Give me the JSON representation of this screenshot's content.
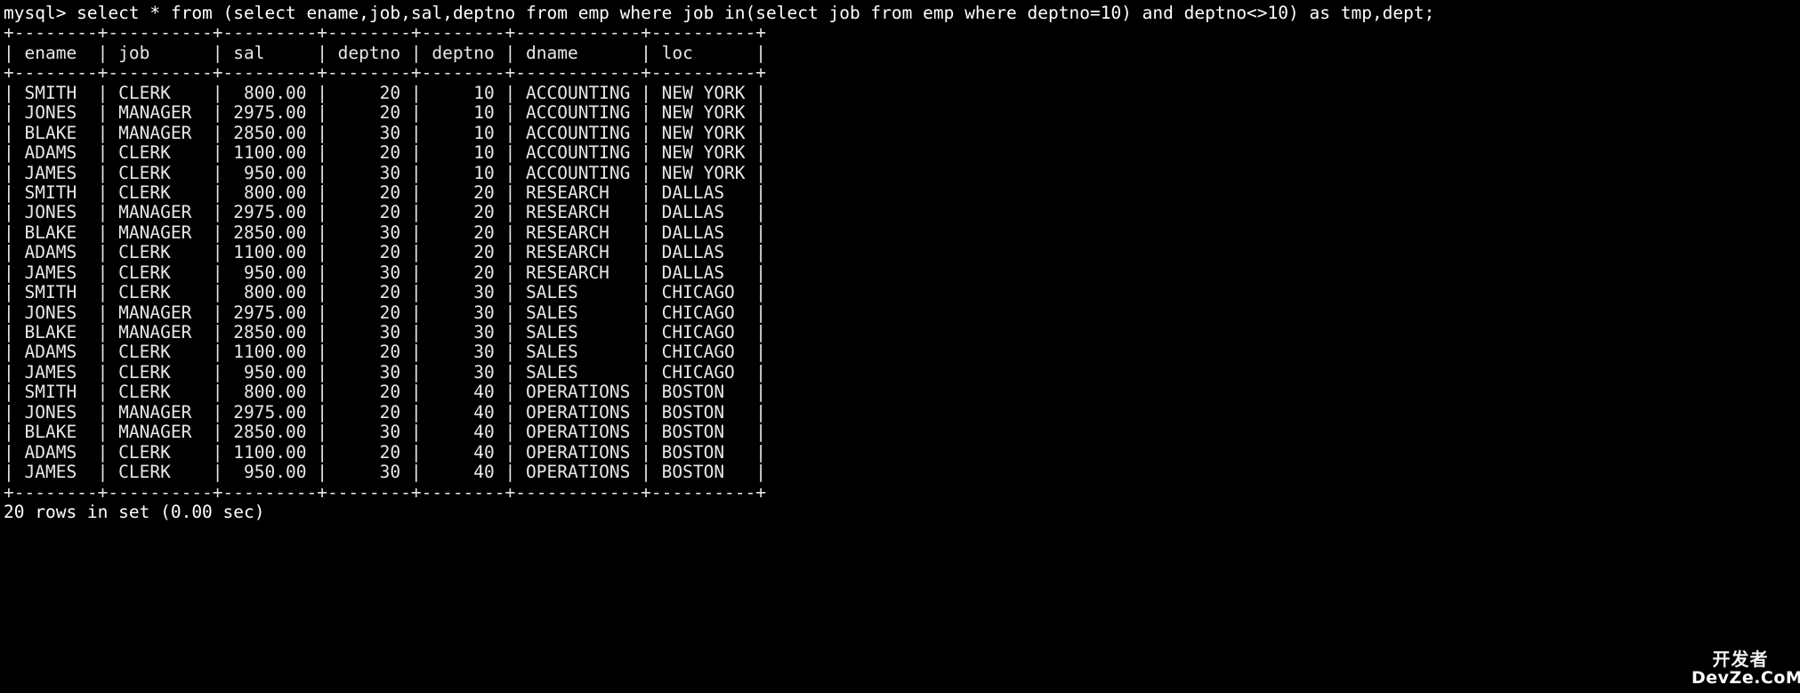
{
  "terminal": {
    "background_color": "#000000",
    "foreground_color": "#e8e8e8",
    "prompt": "mysql>",
    "query": "mysql> select * from (select ename,job,sal,deptno from emp where job in(select job from emp where deptno=10) and deptno<>10) as tmp,dept;",
    "footer": "20 rows in set (0.00 sec)",
    "row_count": 20,
    "elapsed": "0.00 sec"
  },
  "result_table": {
    "border_top": "+--------+----------+---------+--------+--------+------------+----------+",
    "border_header": "+--------+----------+---------+--------+--------+------------+----------+",
    "border_bottom": "+--------+----------+---------+--------+--------+------------+----------+",
    "header_line": "| ename  | job      | sal     | deptno | deptno | dname      | loc      |",
    "columns": [
      "ename",
      "job",
      "sal",
      "deptno",
      "deptno",
      "dname",
      "loc"
    ],
    "rows": [
      "| SMITH  | CLERK    |  800.00 |     20 |     10 | ACCOUNTING | NEW YORK |",
      "| JONES  | MANAGER  | 2975.00 |     20 |     10 | ACCOUNTING | NEW YORK |",
      "| BLAKE  | MANAGER  | 2850.00 |     30 |     10 | ACCOUNTING | NEW YORK |",
      "| ADAMS  | CLERK    | 1100.00 |     20 |     10 | ACCOUNTING | NEW YORK |",
      "| JAMES  | CLERK    |  950.00 |     30 |     10 | ACCOUNTING | NEW YORK |",
      "| SMITH  | CLERK    |  800.00 |     20 |     20 | RESEARCH   | DALLAS   |",
      "| JONES  | MANAGER  | 2975.00 |     20 |     20 | RESEARCH   | DALLAS   |",
      "| BLAKE  | MANAGER  | 2850.00 |     30 |     20 | RESEARCH   | DALLAS   |",
      "| ADAMS  | CLERK    | 1100.00 |     20 |     20 | RESEARCH   | DALLAS   |",
      "| JAMES  | CLERK    |  950.00 |     30 |     20 | RESEARCH   | DALLAS   |",
      "| SMITH  | CLERK    |  800.00 |     20 |     30 | SALES      | CHICAGO  |",
      "| JONES  | MANAGER  | 2975.00 |     20 |     30 | SALES      | CHICAGO  |",
      "| BLAKE  | MANAGER  | 2850.00 |     30 |     30 | SALES      | CHICAGO  |",
      "| ADAMS  | CLERK    | 1100.00 |     20 |     30 | SALES      | CHICAGO  |",
      "| JAMES  | CLERK    |  950.00 |     30 |     30 | SALES      | CHICAGO  |",
      "| SMITH  | CLERK    |  800.00 |     20 |     40 | OPERATIONS | BOSTON   |",
      "| JONES  | MANAGER  | 2975.00 |     20 |     40 | OPERATIONS | BOSTON   |",
      "| BLAKE  | MANAGER  | 2850.00 |     30 |     40 | OPERATIONS | BOSTON   |",
      "| ADAMS  | CLERK    | 1100.00 |     20 |     40 | OPERATIONS | BOSTON   |",
      "| JAMES  | CLERK    |  950.00 |     30 |     40 | OPERATIONS | BOSTON   |"
    ],
    "records": [
      {
        "ename": "SMITH",
        "job": "CLERK",
        "sal": "800.00",
        "deptno_emp": "20",
        "deptno_dept": "10",
        "dname": "ACCOUNTING",
        "loc": "NEW YORK"
      },
      {
        "ename": "JONES",
        "job": "MANAGER",
        "sal": "2975.00",
        "deptno_emp": "20",
        "deptno_dept": "10",
        "dname": "ACCOUNTING",
        "loc": "NEW YORK"
      },
      {
        "ename": "BLAKE",
        "job": "MANAGER",
        "sal": "2850.00",
        "deptno_emp": "30",
        "deptno_dept": "10",
        "dname": "ACCOUNTING",
        "loc": "NEW YORK"
      },
      {
        "ename": "ADAMS",
        "job": "CLERK",
        "sal": "1100.00",
        "deptno_emp": "20",
        "deptno_dept": "10",
        "dname": "ACCOUNTING",
        "loc": "NEW YORK"
      },
      {
        "ename": "JAMES",
        "job": "CLERK",
        "sal": "950.00",
        "deptno_emp": "30",
        "deptno_dept": "10",
        "dname": "ACCOUNTING",
        "loc": "NEW YORK"
      },
      {
        "ename": "SMITH",
        "job": "CLERK",
        "sal": "800.00",
        "deptno_emp": "20",
        "deptno_dept": "20",
        "dname": "RESEARCH",
        "loc": "DALLAS"
      },
      {
        "ename": "JONES",
        "job": "MANAGER",
        "sal": "2975.00",
        "deptno_emp": "20",
        "deptno_dept": "20",
        "dname": "RESEARCH",
        "loc": "DALLAS"
      },
      {
        "ename": "BLAKE",
        "job": "MANAGER",
        "sal": "2850.00",
        "deptno_emp": "30",
        "deptno_dept": "20",
        "dname": "RESEARCH",
        "loc": "DALLAS"
      },
      {
        "ename": "ADAMS",
        "job": "CLERK",
        "sal": "1100.00",
        "deptno_emp": "20",
        "deptno_dept": "20",
        "dname": "RESEARCH",
        "loc": "DALLAS"
      },
      {
        "ename": "JAMES",
        "job": "CLERK",
        "sal": "950.00",
        "deptno_emp": "30",
        "deptno_dept": "20",
        "dname": "RESEARCH",
        "loc": "DALLAS"
      },
      {
        "ename": "SMITH",
        "job": "CLERK",
        "sal": "800.00",
        "deptno_emp": "20",
        "deptno_dept": "30",
        "dname": "SALES",
        "loc": "CHICAGO"
      },
      {
        "ename": "JONES",
        "job": "MANAGER",
        "sal": "2975.00",
        "deptno_emp": "20",
        "deptno_dept": "30",
        "dname": "SALES",
        "loc": "CHICAGO"
      },
      {
        "ename": "BLAKE",
        "job": "MANAGER",
        "sal": "2850.00",
        "deptno_emp": "30",
        "deptno_dept": "30",
        "dname": "SALES",
        "loc": "CHICAGO"
      },
      {
        "ename": "ADAMS",
        "job": "CLERK",
        "sal": "1100.00",
        "deptno_emp": "20",
        "deptno_dept": "30",
        "dname": "SALES",
        "loc": "CHICAGO"
      },
      {
        "ename": "JAMES",
        "job": "CLERK",
        "sal": "950.00",
        "deptno_emp": "30",
        "deptno_dept": "30",
        "dname": "SALES",
        "loc": "CHICAGO"
      },
      {
        "ename": "SMITH",
        "job": "CLERK",
        "sal": "800.00",
        "deptno_emp": "20",
        "deptno_dept": "40",
        "dname": "OPERATIONS",
        "loc": "BOSTON"
      },
      {
        "ename": "JONES",
        "job": "MANAGER",
        "sal": "2975.00",
        "deptno_emp": "20",
        "deptno_dept": "40",
        "dname": "OPERATIONS",
        "loc": "BOSTON"
      },
      {
        "ename": "BLAKE",
        "job": "MANAGER",
        "sal": "2850.00",
        "deptno_emp": "30",
        "deptno_dept": "40",
        "dname": "OPERATIONS",
        "loc": "BOSTON"
      },
      {
        "ename": "ADAMS",
        "job": "CLERK",
        "sal": "1100.00",
        "deptno_emp": "20",
        "deptno_dept": "40",
        "dname": "OPERATIONS",
        "loc": "BOSTON"
      },
      {
        "ename": "JAMES",
        "job": "CLERK",
        "sal": "950.00",
        "deptno_emp": "30",
        "deptno_dept": "40",
        "dname": "OPERATIONS",
        "loc": "BOSTON"
      }
    ]
  },
  "watermark": {
    "top_text": "开发者",
    "bottom_text": "DevZe.CoM"
  }
}
